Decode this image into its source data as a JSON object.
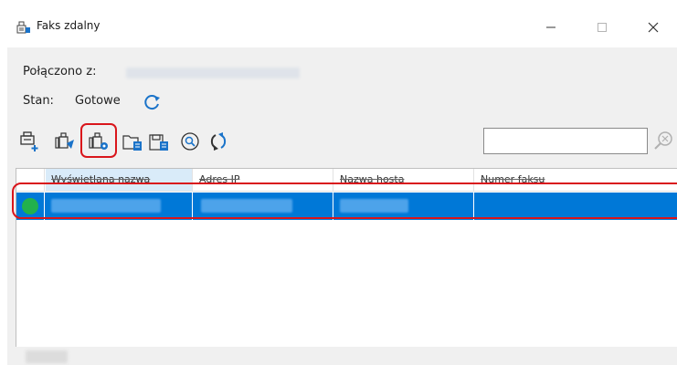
{
  "window": {
    "title": "Faks zdalny",
    "minimize_glyph": "—",
    "maximize_glyph": "☐",
    "close_glyph": "✕"
  },
  "info": {
    "connected_label": "Połączono z:",
    "status_label": "Stan:",
    "status_value": "Gotowe",
    "refresh_icon": "refresh-icon"
  },
  "toolbar": {
    "buttons": [
      "add-fax-icon",
      "send-fax-icon",
      "fax-settings-icon",
      "open-folder-icon",
      "save-icon",
      "search-fax-icon",
      "refresh-list-icon"
    ],
    "highlighted": "fax-settings-icon",
    "search_value": "",
    "search_icon": "search-icon"
  },
  "list": {
    "columns": [
      "Wyświetlana nazwa",
      "Adres IP",
      "Nazwa hosta",
      "Numer faksu"
    ],
    "sorted_column": "Wyświetlana nazwa",
    "selected_row_status": "online"
  },
  "colors": {
    "selection": "#0078d7",
    "highlight": "#d9151b",
    "status_online": "#22b14c",
    "accent_icon": "#1a73c9"
  }
}
